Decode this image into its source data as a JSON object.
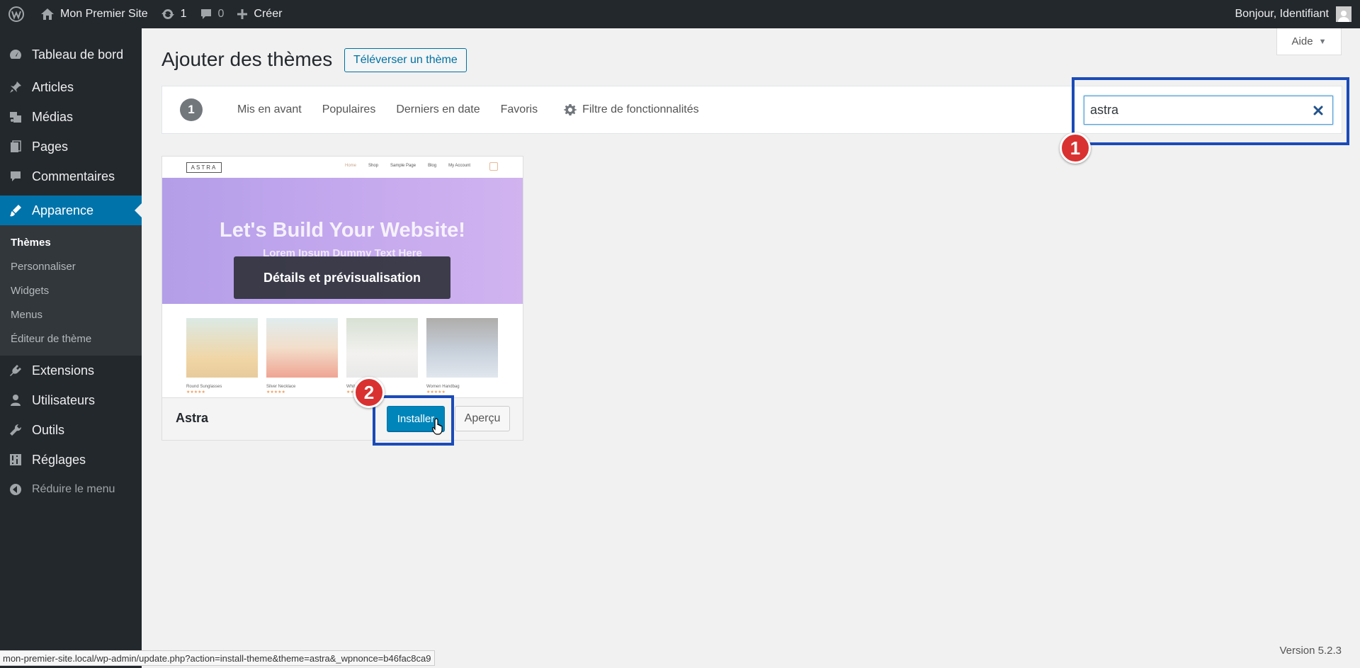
{
  "adminbar": {
    "site_name": "Mon Premier Site",
    "updates_count": "1",
    "comments_count": "0",
    "new_label": "Créer",
    "greeting": "Bonjour, Identifiant"
  },
  "sidebar": {
    "items": [
      {
        "label": "Tableau de bord",
        "icon": "dashboard-icon"
      },
      {
        "label": "Articles",
        "icon": "pin-icon"
      },
      {
        "label": "Médias",
        "icon": "media-icon"
      },
      {
        "label": "Pages",
        "icon": "pages-icon"
      },
      {
        "label": "Commentaires",
        "icon": "comment-icon"
      },
      {
        "label": "Apparence",
        "icon": "brush-icon"
      },
      {
        "label": "Extensions",
        "icon": "plugin-icon"
      },
      {
        "label": "Utilisateurs",
        "icon": "user-icon"
      },
      {
        "label": "Outils",
        "icon": "wrench-icon"
      },
      {
        "label": "Réglages",
        "icon": "settings-icon"
      }
    ],
    "submenu": [
      "Thèmes",
      "Personnaliser",
      "Widgets",
      "Menus",
      "Éditeur de thème"
    ],
    "collapse_label": "Réduire le menu"
  },
  "help": {
    "label": "Aide"
  },
  "page": {
    "title": "Ajouter des thèmes",
    "upload_label": "Téléverser un thème"
  },
  "filter": {
    "count": "1",
    "links": [
      "Mis en avant",
      "Populaires",
      "Derniers en date",
      "Favoris"
    ],
    "feature_filter": "Filtre de fonctionnalités"
  },
  "search": {
    "value": "astra"
  },
  "markers": {
    "one": "1",
    "two": "2"
  },
  "theme": {
    "name": "Astra",
    "details_label": "Détails et prévisualisation",
    "install_label": "Installer",
    "preview_label": "Aperçu",
    "screenshot": {
      "logo": "ASTRA",
      "nav": [
        "Home",
        "Shop",
        "Sample Page",
        "Blog",
        "My Account"
      ],
      "hero_title": "Let's Build Your Website!",
      "hero_subtitle": "Lorem Ipsum Dummy Text Here",
      "products": [
        "Round Sunglasses",
        "Silver Necklace",
        "White Top",
        "Women Handbag"
      ],
      "stars": "★★★★★"
    }
  },
  "footer": {
    "version": "Version 5.2.3",
    "status_url": "mon-premier-site.local/wp-admin/update.php?action=install-theme&theme=astra&_wpnonce=b46fac8ca9"
  },
  "colors": {
    "admin_dark": "#23282d",
    "accent": "#0073aa",
    "install_button": "#0085ba",
    "highlight": "#1b4bb8",
    "marker": "#d93131"
  }
}
